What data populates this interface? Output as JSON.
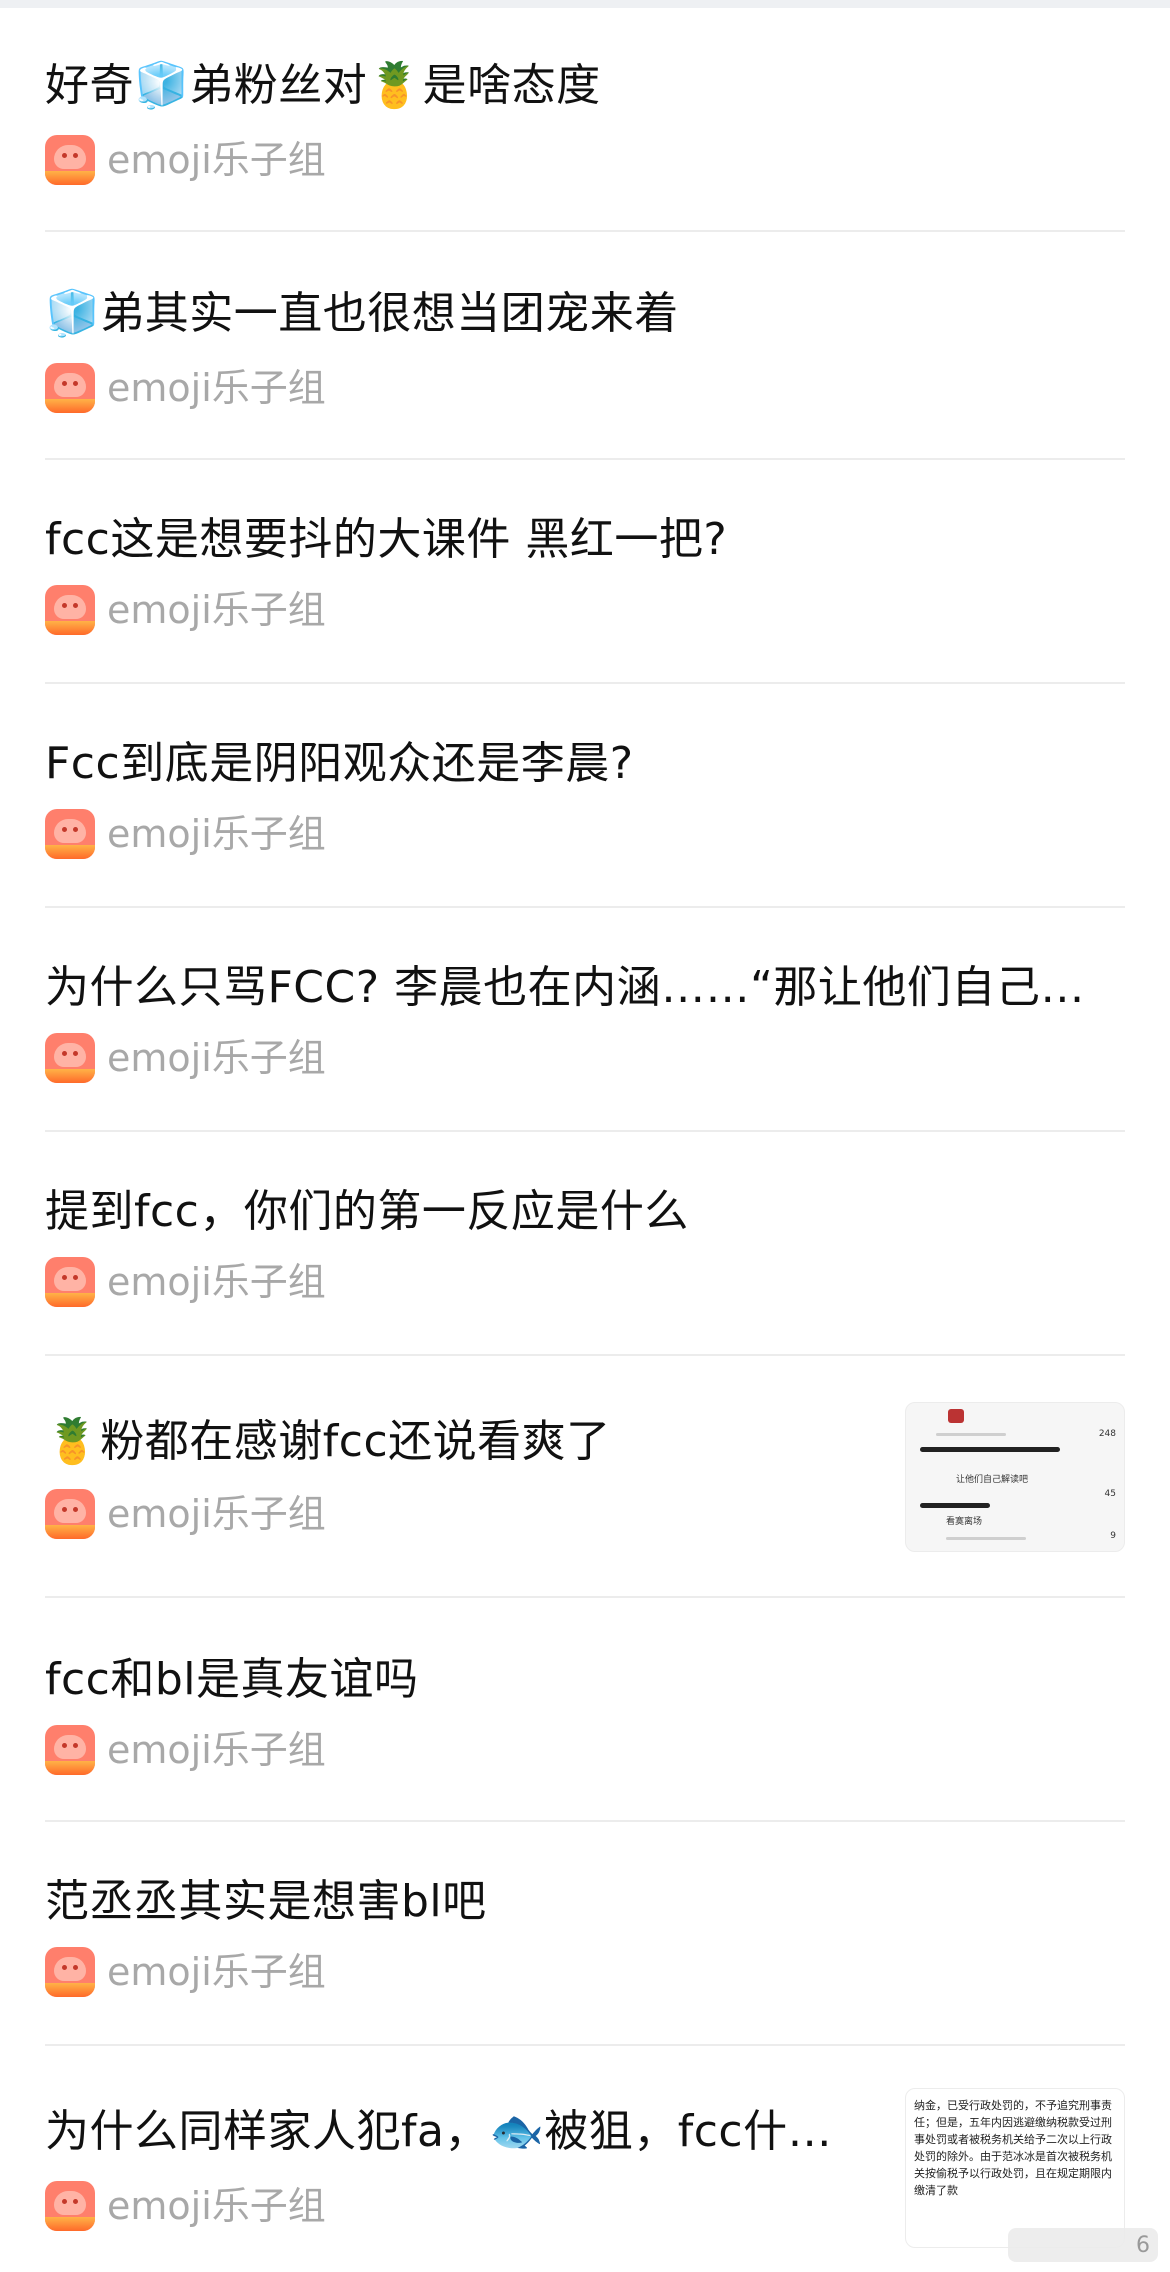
{
  "author_name": "emoji乐子组",
  "posts": [
    {
      "title": "好奇🧊弟粉丝对🍍是啥态度"
    },
    {
      "title": "🧊弟其实一直也很想当团宠来着"
    },
    {
      "title": "fcc这是想要抖的大课件 黑红一把?"
    },
    {
      "title": "Fcc到底是阴阳观众还是李晨?"
    },
    {
      "title": "为什么只骂FCC? 李晨也在内涵……“那让他们自己…"
    },
    {
      "title": "提到fcc，你们的第一反应是什么"
    },
    {
      "title": "🍍粉都在感谢fcc还说看爽了",
      "thumb_lines": [
        "让他们自己解读吧",
        "看寞离场"
      ],
      "thumb_counts": [
        "248",
        "45",
        "9"
      ]
    },
    {
      "title": "fcc和bl是真友谊吗"
    },
    {
      "title": "范丞丞其实是想害bl吧"
    },
    {
      "title": "为什么同样家人犯fa，🐟被狙，fcc什…",
      "thumb_text": "纳金，已受行政处罚的，不予追究刑事责任；但是，五年内因逃避缴纳税款受过刑事处罚或者被税务机关给予二次以上行政处罚的除外。由于范冰冰是首次被税务机关按偷税予以行政处罚，且在规定期限内缴清了款"
    }
  ],
  "corner_badge": "6"
}
